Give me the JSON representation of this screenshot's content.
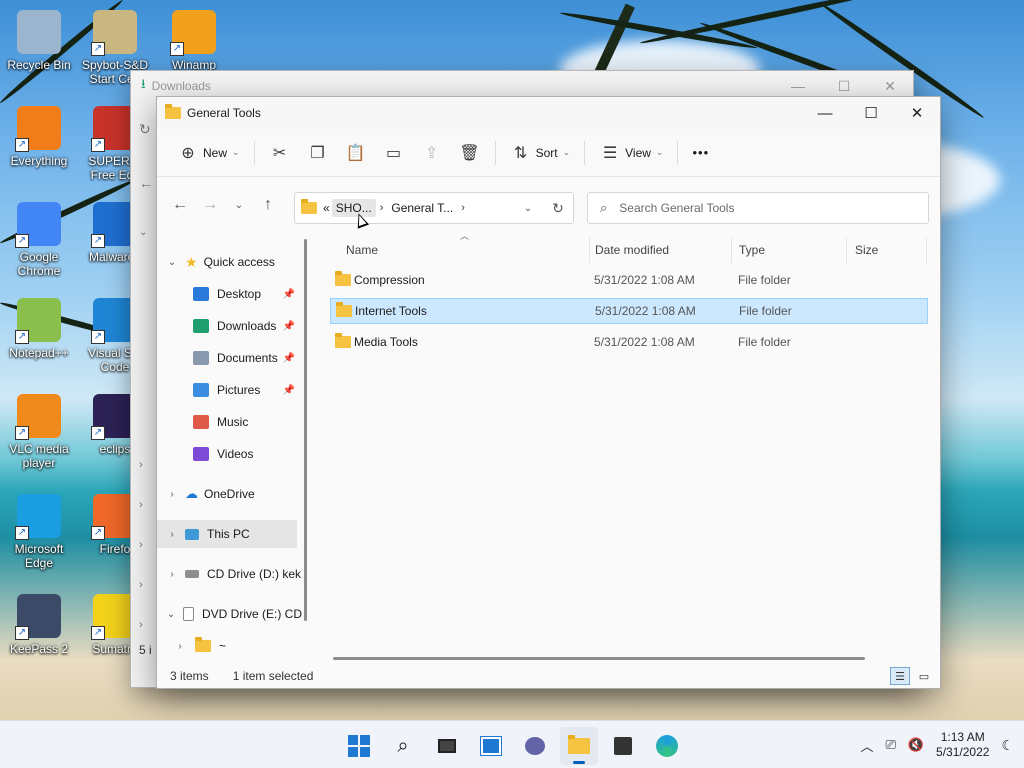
{
  "desktop": {
    "icons": [
      {
        "label": "Recycle Bin",
        "icon": "recycle-bin-icon",
        "color": "#9bb5cf"
      },
      {
        "label": "Spybot-S&D Start Cen",
        "icon": "spybot-icon",
        "color": "#c9b680"
      },
      {
        "label": "Winamp",
        "icon": "winamp-icon",
        "color": "#f2a11c"
      },
      {
        "label": "Everything",
        "icon": "everything-search-icon",
        "color": "#f07c1a"
      },
      {
        "label": "SUPERAr Free Edit",
        "icon": "superantispyware-icon",
        "color": "#c8332b"
      },
      {
        "label": "Google Chrome",
        "icon": "chrome-icon",
        "color": "#4285f4"
      },
      {
        "label": "Malwareb",
        "icon": "malwarebytes-icon",
        "color": "#1f6fd1"
      },
      {
        "label": "Notepad++",
        "icon": "notepadpp-icon",
        "color": "#8bbf4d"
      },
      {
        "label": "Visual Stu Code",
        "icon": "vscode-icon",
        "color": "#1f86d6"
      },
      {
        "label": "VLC media player",
        "icon": "vlc-icon",
        "color": "#f08a1c"
      },
      {
        "label": "eclips",
        "icon": "eclipse-icon",
        "color": "#2c2255"
      },
      {
        "label": "Microsoft Edge",
        "icon": "edge-icon",
        "color": "#1b9de2"
      },
      {
        "label": "Firefo",
        "icon": "firefox-icon",
        "color": "#f0682a"
      },
      {
        "label": "KeePass 2",
        "icon": "keepass-icon",
        "color": "#3b4a66"
      },
      {
        "label": "Sumatra",
        "icon": "sumatra-pdf-icon",
        "color": "#f2d21a"
      }
    ]
  },
  "downloads_window": {
    "title": "Downloads",
    "side_labels": [
      "5 i"
    ]
  },
  "explorer": {
    "title": "General Tools",
    "toolbar": {
      "new_label": "New",
      "sort_label": "Sort",
      "view_label": "View",
      "more_label": "•••"
    },
    "address": {
      "overflow": "«",
      "crumbs": [
        "SHO...",
        "General T..."
      ]
    },
    "search": {
      "placeholder": "Search General Tools"
    },
    "nav": {
      "quick_access": "Quick access",
      "items": [
        {
          "label": "Desktop",
          "color": "#2b79d8",
          "pinned": true
        },
        {
          "label": "Downloads",
          "color": "#1f9e6f",
          "pinned": true
        },
        {
          "label": "Documents",
          "color": "#8a98ad",
          "pinned": true
        },
        {
          "label": "Pictures",
          "color": "#3a8de0",
          "pinned": true
        },
        {
          "label": "Music",
          "color": "#e05a4a",
          "pinned": false
        },
        {
          "label": "Videos",
          "color": "#7d4ad6",
          "pinned": false
        }
      ],
      "onedrive": "OneDrive",
      "this_pc": "This PC",
      "cd_drive": "CD Drive (D:) kek",
      "dvd_drive": "DVD Drive (E:) CD",
      "sub_folder": "~"
    },
    "columns": {
      "name": "Name",
      "date": "Date modified",
      "type": "Type",
      "size": "Size"
    },
    "files": [
      {
        "name": "Compression",
        "date": "5/31/2022 1:08 AM",
        "type": "File folder",
        "selected": false
      },
      {
        "name": "Internet Tools",
        "date": "5/31/2022 1:08 AM",
        "type": "File folder",
        "selected": true
      },
      {
        "name": "Media Tools",
        "date": "5/31/2022 1:08 AM",
        "type": "File folder",
        "selected": false
      }
    ],
    "status": {
      "count": "3 items",
      "selection": "1 item selected"
    }
  },
  "taskbar": {
    "apps": [
      "windows-start-icon",
      "search-icon",
      "task-view-icon",
      "widgets-icon",
      "teams-chat-icon",
      "file-explorer-icon",
      "store-icon",
      "edge-icon"
    ],
    "time": "1:13 AM",
    "date": "5/31/2022"
  }
}
